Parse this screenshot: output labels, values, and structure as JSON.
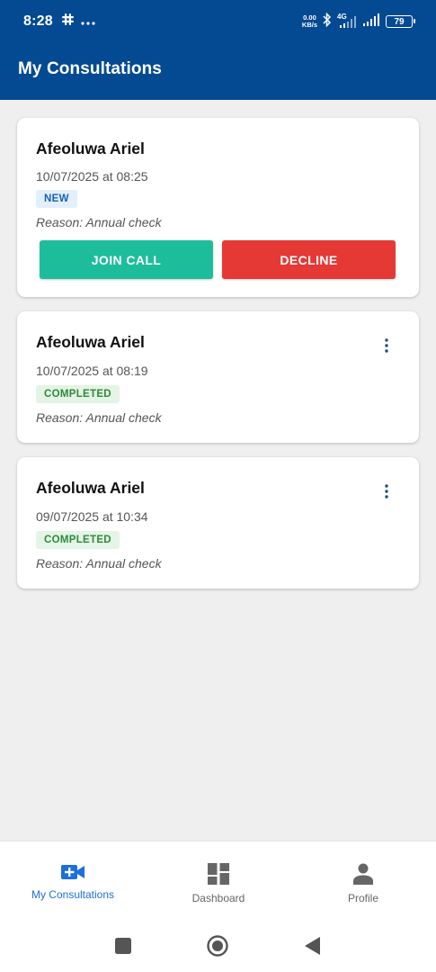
{
  "status_bar": {
    "time": "8:28",
    "net_speed_value": "0.00",
    "net_speed_unit": "KB/s",
    "network_type": "4G",
    "battery": "79",
    "icons": [
      "slack-icon",
      "more-horizontal-icon",
      "bluetooth-icon",
      "signal-icon",
      "signal-icon",
      "battery-icon"
    ]
  },
  "header": {
    "title": "My Consultations",
    "background_color": "#044a93"
  },
  "consultations": [
    {
      "name": "Afeoluwa Ariel",
      "datetime": "10/07/2025 at 08:25",
      "status": "NEW",
      "reason": "Reason: Annual check",
      "actions": {
        "join": "JOIN CALL",
        "decline": "DECLINE"
      }
    },
    {
      "name": "Afeoluwa Ariel",
      "datetime": "10/07/2025 at 08:19",
      "status": "COMPLETED",
      "reason": "Reason: Annual check"
    },
    {
      "name": "Afeoluwa Ariel",
      "datetime": "09/07/2025 at 10:34",
      "status": "COMPLETED",
      "reason": "Reason: Annual check"
    }
  ],
  "bottom_nav": {
    "items": [
      {
        "label": "My Consultations",
        "icon": "video-add-icon",
        "active": true
      },
      {
        "label": "Dashboard",
        "icon": "dashboard-icon",
        "active": false
      },
      {
        "label": "Profile",
        "icon": "person-icon",
        "active": false
      }
    ]
  },
  "colors": {
    "primary": "#044a93",
    "join": "#1dbd9c",
    "decline": "#e53935",
    "active_nav": "#1e6fd9"
  }
}
